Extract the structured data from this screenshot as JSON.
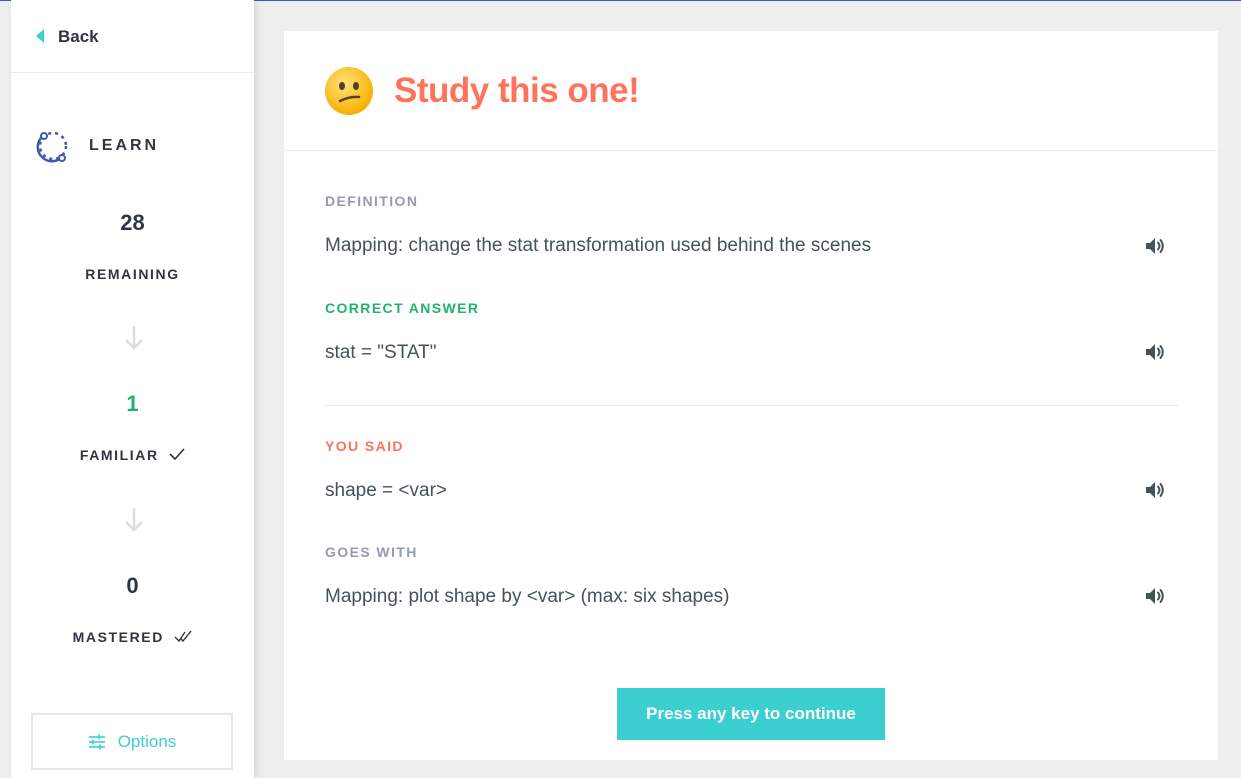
{
  "sidebar": {
    "back_label": "Back",
    "mode_label": "LEARN",
    "remaining": {
      "count": "28",
      "label": "REMAINING"
    },
    "familiar": {
      "count": "1",
      "label": "FAMILIAR"
    },
    "mastered": {
      "count": "0",
      "label": "MASTERED"
    },
    "options_label": "Options"
  },
  "card": {
    "title": "Study this one!",
    "definition": {
      "label": "DEFINITION",
      "text": "Mapping: change the stat transformation used behind the scenes"
    },
    "correct": {
      "label": "CORRECT ANSWER",
      "text": "stat = \"STAT\""
    },
    "you_said": {
      "label": "YOU SAID",
      "text": "shape = <var>"
    },
    "goes_with": {
      "label": "GOES WITH",
      "text": "Mapping: plot shape by <var> (max: six shapes)"
    },
    "continue_label": "Press any key to continue"
  },
  "colors": {
    "accent": "#3ccfcf",
    "title": "#ff725b",
    "correct": "#23b26d",
    "muted": "#939bb4"
  },
  "icons": [
    "chevron-left-icon",
    "learn-icon",
    "arrow-down-icon",
    "check-icon",
    "double-check-icon",
    "options-sliders-icon",
    "confused-face-icon",
    "speaker-icon"
  ]
}
